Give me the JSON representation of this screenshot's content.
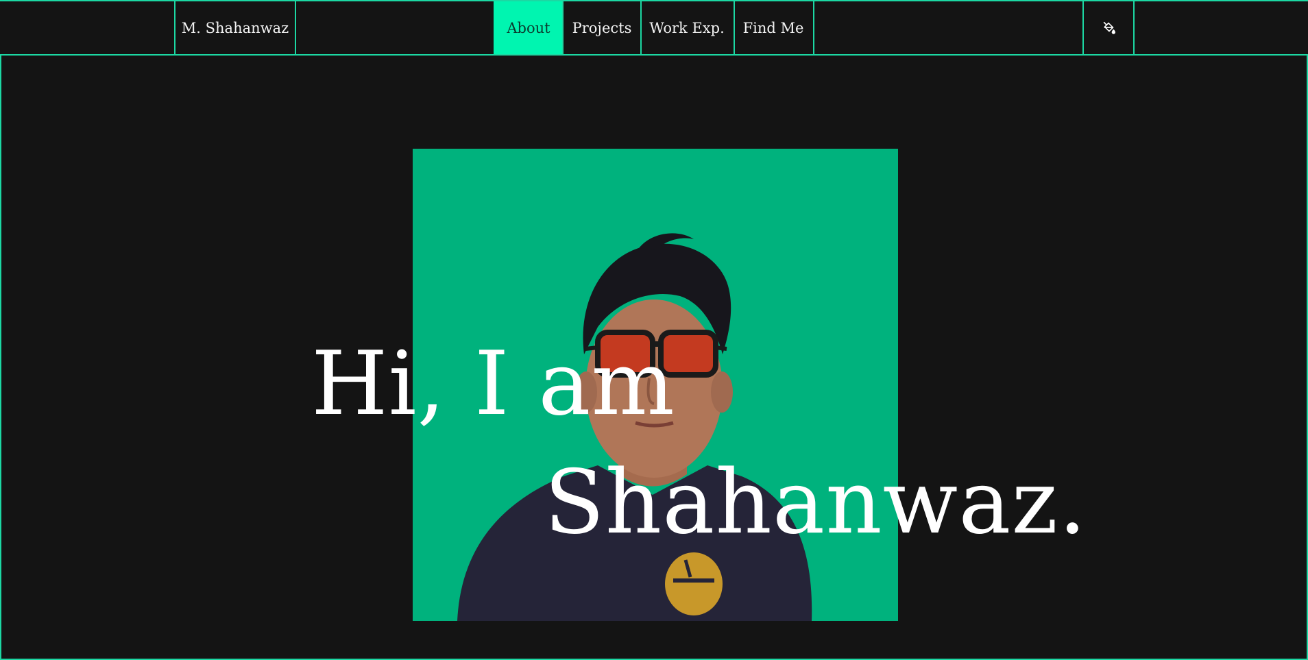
{
  "nav": {
    "brand": "M. Shahanwaz",
    "tabs": [
      {
        "label": "About",
        "active": true
      },
      {
        "label": "Projects",
        "active": false
      },
      {
        "label": "Work Exp.",
        "active": false
      },
      {
        "label": "Find Me",
        "active": false
      }
    ],
    "theme_icon": "paint-bucket-icon"
  },
  "hero": {
    "greeting_line1": "Hi, I am",
    "greeting_line2": "Shahanwaz.",
    "scroll_icon": "mouse-scroll-icon"
  },
  "colors": {
    "accent": "#1cd8a3",
    "active_tab": "#00f5b0",
    "portrait_bg": "#00b27d",
    "page_bg": "#141414",
    "text": "#ffffff"
  }
}
